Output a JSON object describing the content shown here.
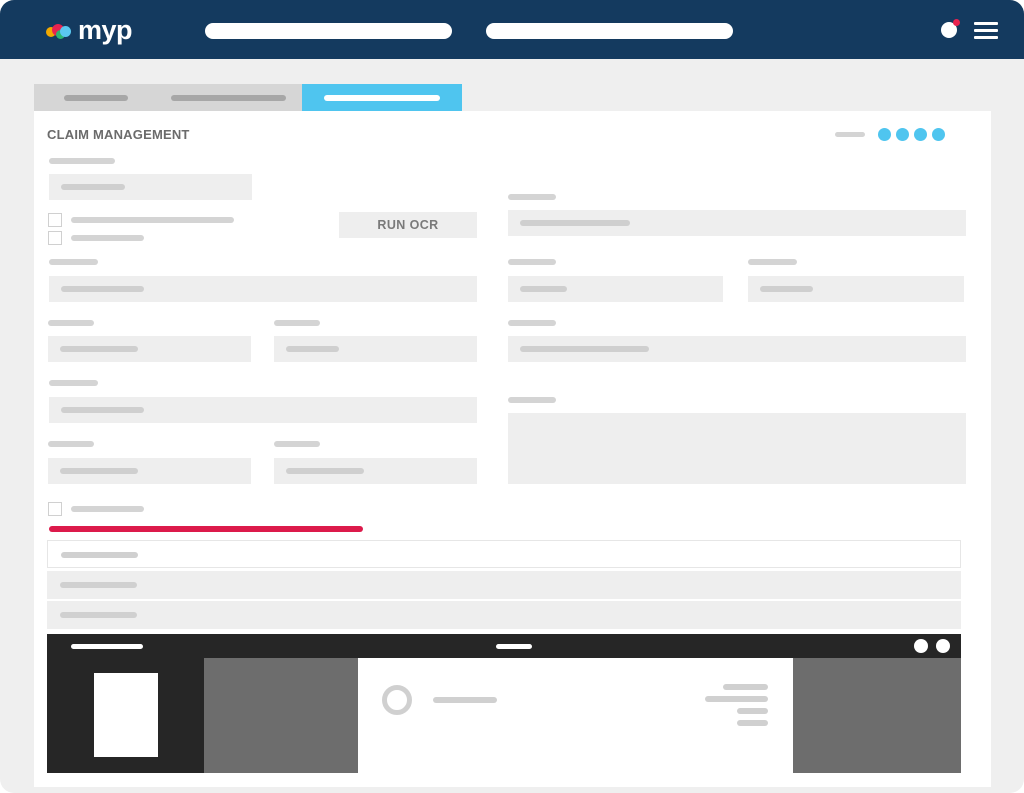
{
  "app": {
    "logo_text": "myp",
    "colors": {
      "topbar": "#143a5f",
      "accent": "#4fc5ef",
      "alert": "#dc1a4b",
      "viewer_bg": "#262626"
    }
  },
  "header": {
    "icons": [
      "user-avatar-icon",
      "notification-badge-icon",
      "hamburger-menu-icon"
    ]
  },
  "form": {
    "title": "CLAIM MANAGEMENT",
    "run_ocr_label": "RUN OCR",
    "stepper_steps": 4
  }
}
